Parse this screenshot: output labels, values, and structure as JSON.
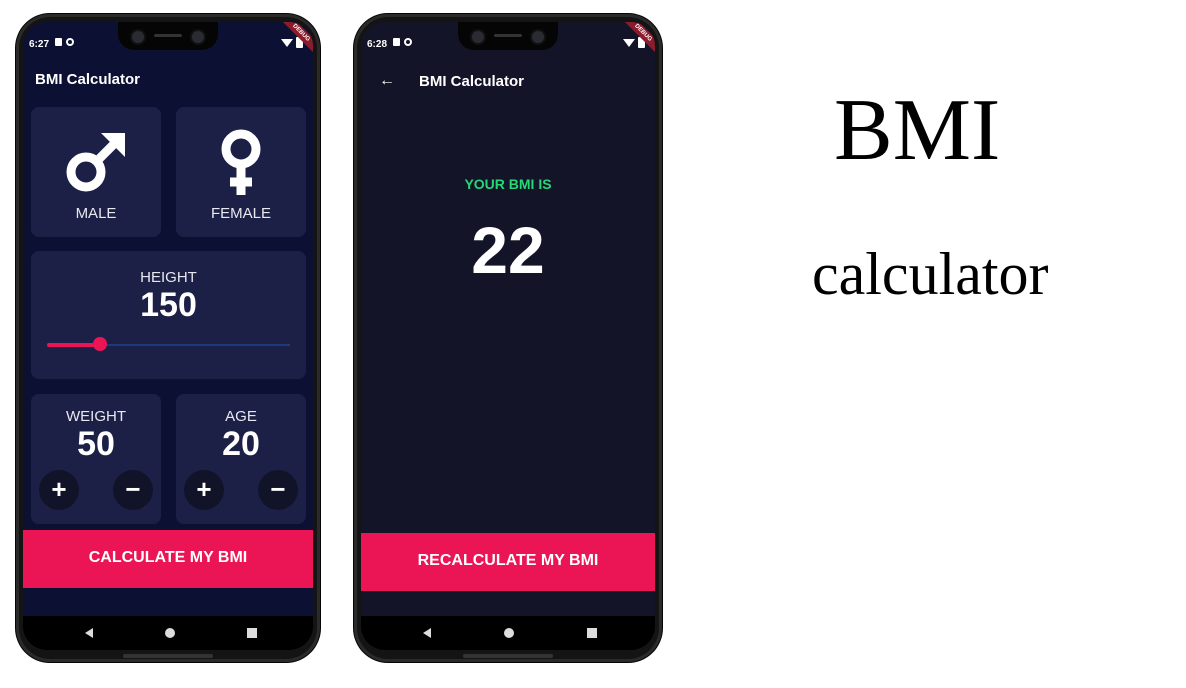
{
  "phone1": {
    "status": {
      "time": "6:27",
      "debug": "DEBUG"
    },
    "app_title": "BMI Calculator",
    "male_label": "MALE",
    "female_label": "FEMALE",
    "height_label": "HEIGHT",
    "height_value": "150",
    "height_slider_fraction": 0.22,
    "weight_label": "WEIGHT",
    "weight_value": "50",
    "age_label": "AGE",
    "age_value": "20",
    "plus": "+",
    "minus": "−",
    "calculate_label": "CALCULATE MY BMI"
  },
  "phone2": {
    "status": {
      "time": "6:28",
      "debug": "DEBUG"
    },
    "app_title": "BMI Calculator",
    "back": "←",
    "result_label": "YOUR BMI IS",
    "result_value": "22",
    "recalculate_label": "RECALCULATE MY BMI"
  },
  "caption": {
    "title": "BMI",
    "subtitle": "calculator"
  },
  "colors": {
    "accent": "#eb1555",
    "card": "#1c2047",
    "background": "#0c1133",
    "result": "#24d876"
  },
  "icons": [
    "male-icon",
    "female-icon",
    "back-arrow-icon",
    "wifi-icon",
    "battery-icon"
  ]
}
